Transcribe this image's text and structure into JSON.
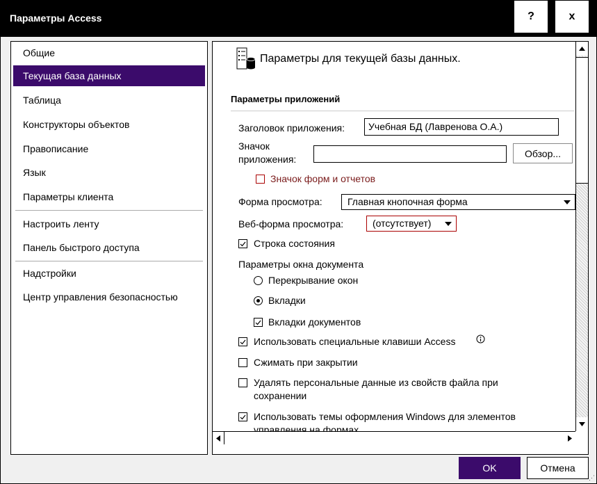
{
  "window": {
    "title": "Параметры Access",
    "help_label": "?",
    "close_label": "x"
  },
  "nav": {
    "items": [
      {
        "label": "Общие"
      },
      {
        "label": "Текущая база данных"
      },
      {
        "label": "Таблица"
      },
      {
        "label": "Конструкторы объектов"
      },
      {
        "label": "Правописание"
      },
      {
        "label": "Язык"
      },
      {
        "label": "Параметры клиента"
      },
      {
        "label": "Настроить ленту"
      },
      {
        "label": "Панель быстрого доступа"
      },
      {
        "label": "Надстройки"
      },
      {
        "label": "Центр управления безопасностью"
      }
    ],
    "selected": "Текущая база данных"
  },
  "content": {
    "header": "Параметры для текущей базы данных.",
    "section_title": "Параметры приложений",
    "app_title_label": "Заголовок приложения:",
    "app_title_value": "Учебная БД (Лавренова О.А.)",
    "app_icon_label_1": "Значок",
    "app_icon_label_2": "приложения:",
    "app_icon_value": "",
    "browse_label": "Обзор...",
    "forms_icon_label": "Значок форм и отчетов",
    "display_form_label": "Форма просмотра:",
    "display_form_value": "Главная кнопочная форма",
    "web_form_label": "Веб-форма просмотра:",
    "web_form_value": "(отсутствует)",
    "status_bar_label": "Строка состояния",
    "doc_window_label": "Параметры окна документа",
    "overlap_label": "Перекрывание окон",
    "tabs_label": "Вкладки",
    "doc_tabs_label": "Вкладки документов",
    "special_keys_label": "Использовать специальные клавиши Access",
    "compact_label": "Сжимать при закрытии",
    "remove_personal_label_1": "Удалять персональные данные из свойств файла при",
    "remove_personal_label_2": "сохранении",
    "themes_label_1": "Использовать темы оформления Windows для элементов",
    "themes_label_2": "управления на формах"
  },
  "footer": {
    "ok_label": "OK",
    "cancel_label": "Отмена"
  },
  "colors": {
    "accent": "#3b0b6b",
    "warning_text": "#7a1b1b"
  },
  "icons": [
    "database-settings-icon",
    "info-icon",
    "chevron-down-icon",
    "scroll-up-icon",
    "scroll-down-icon",
    "scroll-left-icon",
    "scroll-right-icon",
    "checkmark-icon"
  ]
}
